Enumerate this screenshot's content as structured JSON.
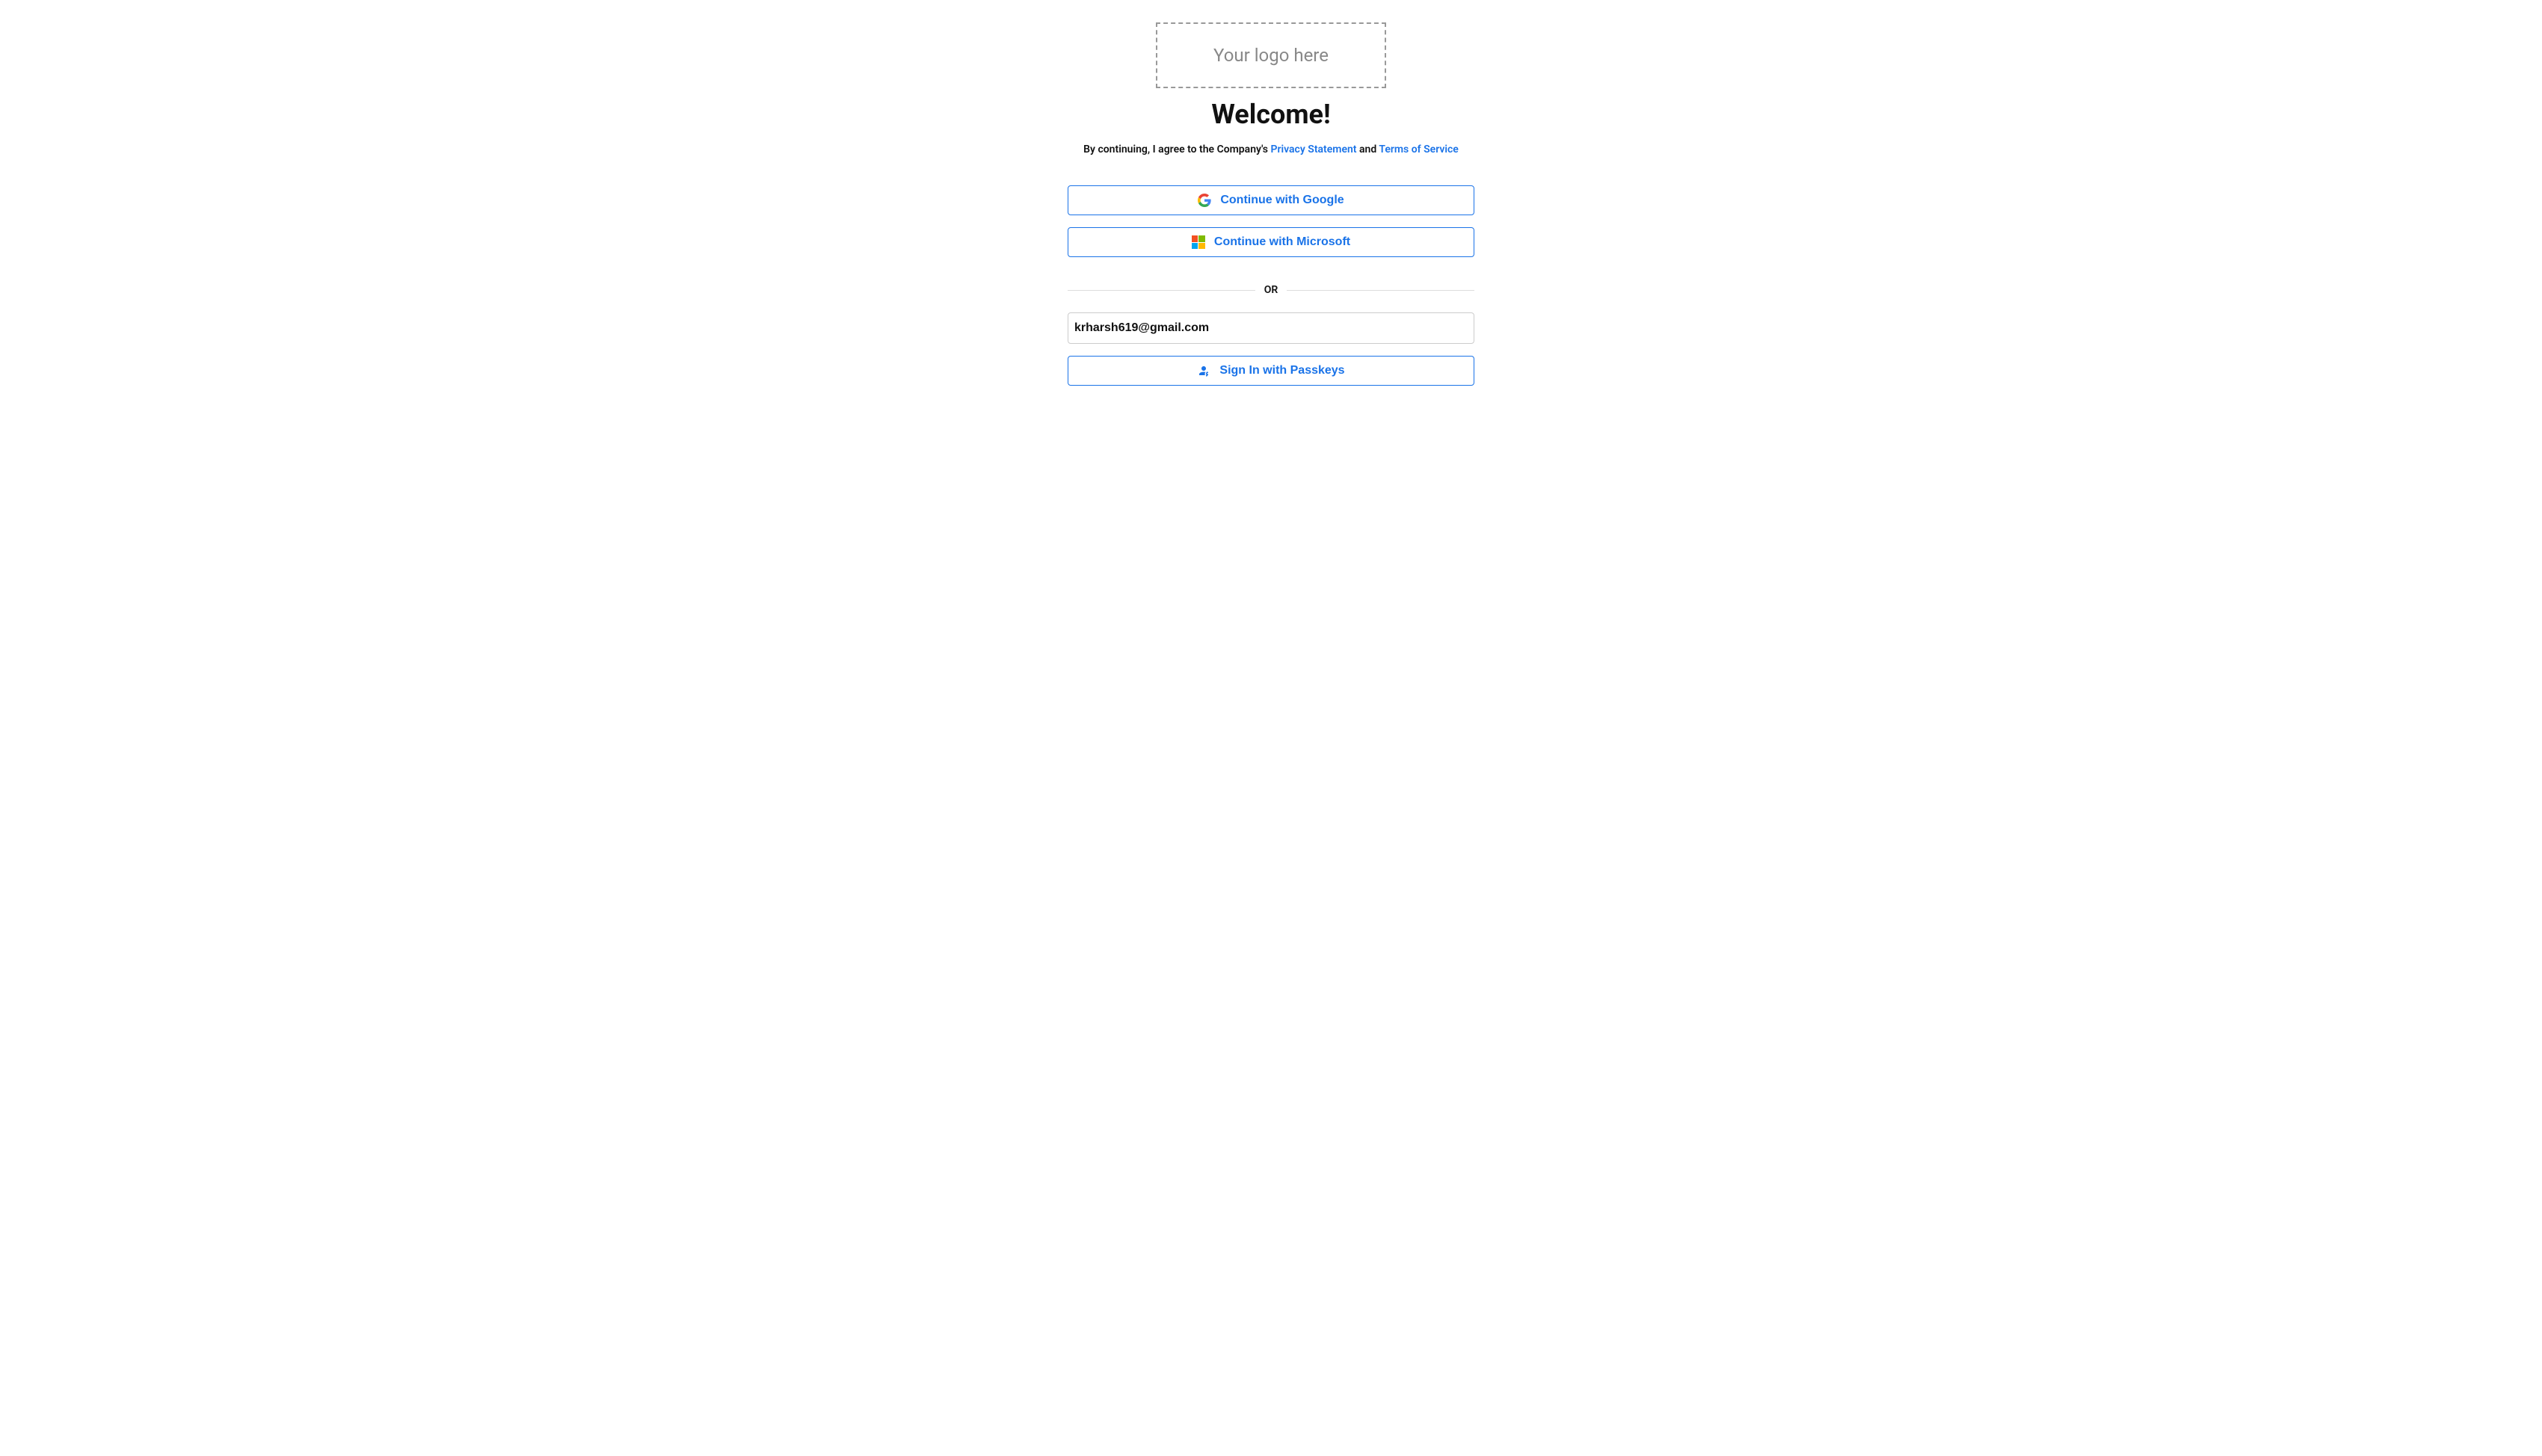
{
  "logo": {
    "placeholder": "Your logo here"
  },
  "heading": "Welcome!",
  "consent": {
    "prefix": "By continuing, I agree to the Company's ",
    "privacy_link": "Privacy Statement",
    "middle": " and ",
    "terms_link": "Terms of Service"
  },
  "auth": {
    "google_label": "Continue with Google",
    "microsoft_label": "Continue with Microsoft",
    "passkey_label": "Sign In with Passkeys"
  },
  "divider": "OR",
  "email": {
    "value": "krharsh619@gmail.com"
  }
}
